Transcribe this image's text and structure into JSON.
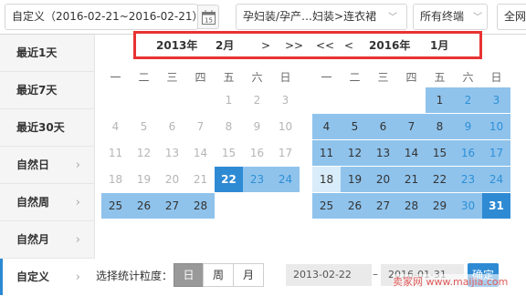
{
  "top": {
    "range_label": "自定义（2016-02-21~2016-02-21）",
    "calendar_icon_text": "15",
    "category": "孕妇装/孕产…妇装>连衣裙",
    "terminal": "所有终端",
    "overflow": "全网"
  },
  "sidebar": {
    "items": [
      {
        "label": "最近1天"
      },
      {
        "label": "最近7天"
      },
      {
        "label": "最近30天"
      },
      {
        "label": "自然日",
        "arrow": "›"
      },
      {
        "label": "自然周",
        "arrow": "›"
      },
      {
        "label": "自然月",
        "arrow": "›"
      },
      {
        "label": "自定义",
        "arrow": "›"
      }
    ]
  },
  "nav": {
    "left_year": "2013年",
    "left_month": "2月",
    "next": ">",
    "next_year": ">>",
    "prev_year": "<<",
    "prev": "<",
    "right_year": "2016年",
    "right_month": "1月"
  },
  "weekdays": [
    "一",
    "二",
    "三",
    "四",
    "五",
    "六",
    "日"
  ],
  "calendars": {
    "left": [
      [
        "",
        "",
        "",
        "",
        "1",
        "2",
        "3"
      ],
      [
        "4",
        "5",
        "6",
        "7",
        "8",
        "9",
        "10"
      ],
      [
        "11",
        "12",
        "13",
        "14",
        "15",
        "16",
        "17"
      ],
      [
        "18",
        "19",
        "20",
        "21",
        "22",
        "23",
        "24"
      ],
      [
        "25",
        "26",
        "27",
        "28",
        "",
        "",
        ""
      ]
    ],
    "right": [
      [
        "",
        "",
        "",
        "",
        "1",
        "2",
        "3"
      ],
      [
        "4",
        "5",
        "6",
        "7",
        "8",
        "9",
        "10"
      ],
      [
        "11",
        "12",
        "13",
        "14",
        "15",
        "16",
        "17"
      ],
      [
        "18",
        "19",
        "20",
        "21",
        "22",
        "23",
        "24"
      ],
      [
        "25",
        "26",
        "27",
        "28",
        "29",
        "30",
        "31"
      ]
    ]
  },
  "footer": {
    "granularity_label": "选择统计粒度：",
    "day": "日",
    "week": "周",
    "month": "月",
    "start_date": "2013-02-22",
    "separator": "–",
    "end_date": "2016-01-31",
    "confirm": "确定"
  },
  "watermark": "卖家网 www.maijia.com",
  "colors": {
    "range_bg": "#8fc3ec",
    "weekend_text": "#2e8fd6",
    "selected_bg": "#2f8ad4",
    "start_bg": "#d8ecfa",
    "disabled_text": "#b5b5b5"
  }
}
